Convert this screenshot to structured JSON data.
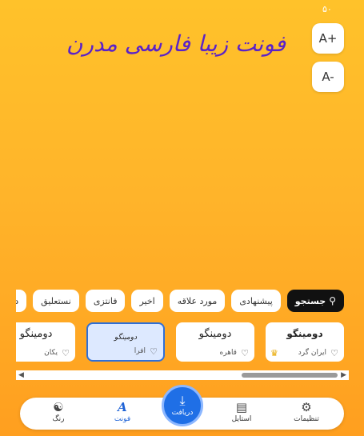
{
  "font_size_value": "۵۰",
  "zoom": {
    "increase_label": "A+",
    "decrease_label": "A-"
  },
  "preview_text": "فونت زیبا فارسی مدرن",
  "chips": {
    "search": "جستجو",
    "suggested": "پیشنهادی",
    "favorites": "مورد علاقه",
    "recent": "اخیر",
    "fantasy": "فانتزی",
    "nastaliq": "نستعلیق",
    "handwriting": "دست‌نویس"
  },
  "cards": [
    {
      "name": "دومینگو",
      "sub": "ایران گرد",
      "premium": true
    },
    {
      "name": "دومینگو",
      "sub": "قاهره",
      "premium": false
    },
    {
      "name": "دومینگو",
      "sub": "افرا",
      "premium": false
    },
    {
      "name": "دومینگو",
      "sub": "یکان",
      "premium": false
    }
  ],
  "nav": {
    "settings": "تنظیمات",
    "style": "استایل",
    "download": "دریافت",
    "font": "فونت",
    "color": "رنگ"
  },
  "colors": {
    "accent": "#1f63d6",
    "preview": "#5a22c8",
    "bg_top": "#ffc22a",
    "bg_bottom": "#ff9f1f"
  }
}
